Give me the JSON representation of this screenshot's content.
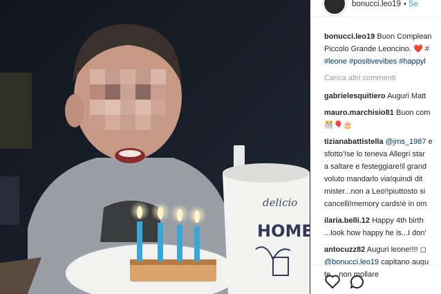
{
  "header": {
    "username": "bonucci.leo19",
    "separator": "•",
    "follow_label": "Se"
  },
  "caption": {
    "username": "bonucci.leo19",
    "line1": "Buon Complean",
    "line2": "Piccolo Grande Leoncino. ❤️ #",
    "tags": [
      "#leone",
      "#positivevibes",
      "#happyl"
    ]
  },
  "load_more": "Carica altri commenti",
  "comments": [
    {
      "user": "gabrielesquitiero",
      "lines": [
        "Auguri Matt"
      ]
    },
    {
      "user": "mauro.marchisio81",
      "lines": [
        "Buon com",
        "🎊🎈🎂"
      ]
    },
    {
      "user": "tizianabattistella",
      "mention": "@jms_1987",
      "lines": [
        "e",
        "sfotto'!se lo teneva Allegri star",
        "a saltare e festeggiare!il grand",
        "voluto mandarlo via!quindi dit",
        "mister...non a Leo!!piuttosto si",
        "cancelli!memory cards!è in om"
      ]
    },
    {
      "user": "ilaria.belli.12",
      "lines": [
        "Happy 4th birth",
        "...look how happy he is...I don'"
      ]
    },
    {
      "user": "antocuzz82",
      "lines": [
        "Auguri leone!!!! ◻"
      ],
      "mention": "@bonucci.leo19",
      "tail": [
        "capitano augu",
        "te....non mollare"
      ]
    }
  ],
  "photo": {
    "mug_text_1": "delicio",
    "mug_text_2": "HOMEM"
  },
  "icons": [
    "heart-icon",
    "comment-icon"
  ]
}
